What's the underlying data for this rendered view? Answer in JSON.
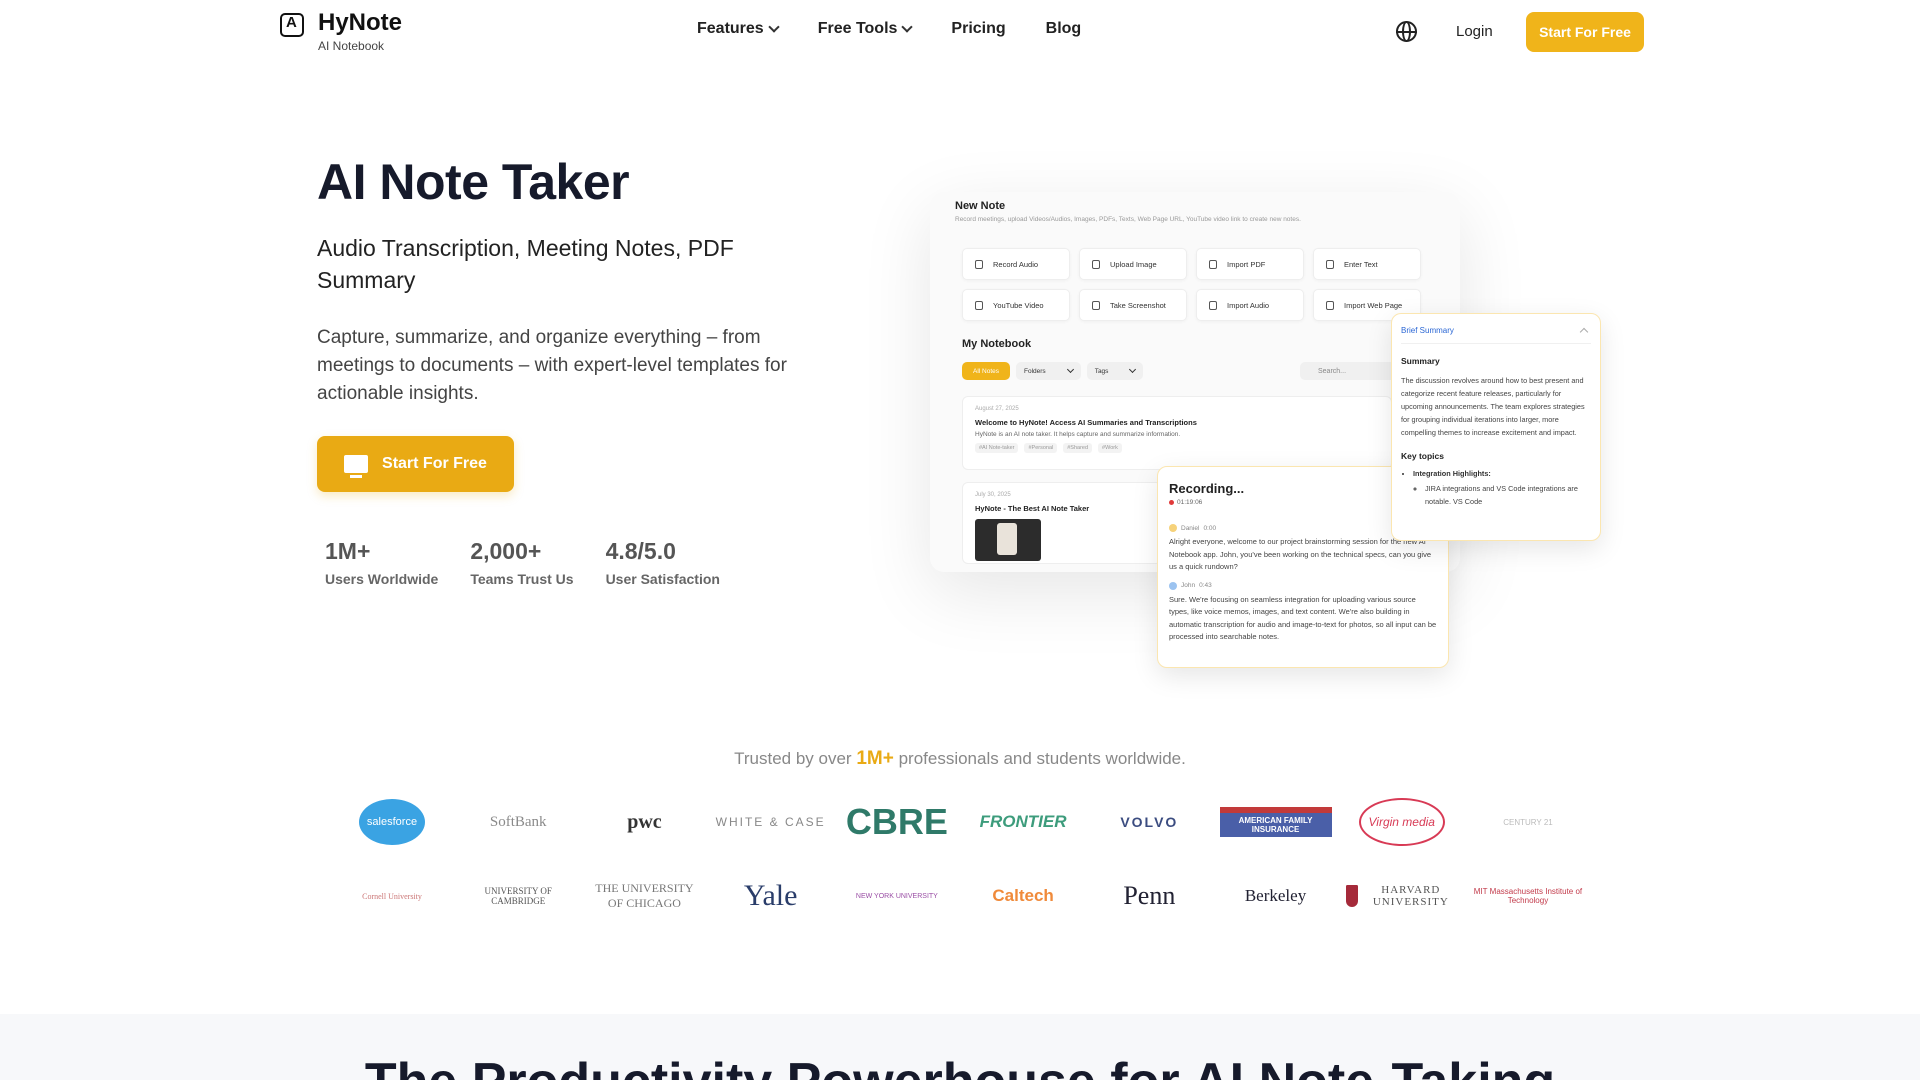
{
  "nav": {
    "brand": "HyNote",
    "brand_sub": "AI Notebook",
    "links": [
      "Features",
      "Free Tools",
      "Pricing",
      "Blog"
    ],
    "login": "Login",
    "cta": "Start For Free"
  },
  "hero": {
    "title": "AI Note Taker",
    "subtitle": "Audio Transcription, Meeting Notes, PDF Summary",
    "description": "Capture, summarize, and organize everything – from meetings to documents – with expert-level templates for actionable insights.",
    "cta": "Start For Free",
    "stats": [
      {
        "num": "1M+",
        "label": "Users Worldwide"
      },
      {
        "num": "2,000+",
        "label": "Teams Trust Us"
      },
      {
        "num": "4.8/5.0",
        "label": "User Satisfaction"
      }
    ]
  },
  "mockup": {
    "new_note_title": "New Note",
    "new_note_hint": "Record meetings, upload Videos/Audios, Images, PDFs, Texts, Web Page URL, YouTube video link to create new notes.",
    "actions": [
      "Record Audio",
      "Upload Image",
      "Import PDF",
      "Enter Text",
      "YouTube Video",
      "Take Screenshot",
      "Import Audio",
      "Import Web Page"
    ],
    "notebook_title": "My Notebook",
    "filters": {
      "all": "All Notes",
      "folders": "Folders",
      "tags": "Tags",
      "search": "Search..."
    },
    "note1": {
      "date": "August 27, 2025",
      "title": "Welcome to HyNote! Access AI Summaries and Transcriptions",
      "desc": "HyNote is an AI note taker. It helps capture and summarize information.",
      "tags": [
        "#AI Note-taker",
        "#Personal",
        "#Shared",
        "#Work"
      ]
    },
    "note2": {
      "date": "July 30, 2025",
      "title": "HyNote - The Best AI Note Taker"
    },
    "recording": {
      "title": "Recording...",
      "time": "01:19:06",
      "speaker1": "Daniel",
      "speaker1_time": "0:00",
      "text1": "Alright everyone, welcome to our project brainstorming session for the new AI Notebook app. John, you've been working on the technical specs, can you give us a quick rundown?",
      "speaker2": "John",
      "speaker2_time": "0:43",
      "text2": "Sure. We're focusing on seamless integration for uploading various source types, like voice memos, images, and text content. We're also building in automatic transcription for audio and image-to-text for photos, so all input can be processed into searchable notes."
    },
    "summary": {
      "header": "Brief Summary",
      "title": "Summary",
      "text": "The discussion revolves around how to best present and categorize recent feature releases, particularly for upcoming announcements. The team explores strategies for grouping individual iterations into larger, more compelling themes to increase excitement and impact.",
      "key_topics": "Key topics",
      "topic1": "Integration Highlights:",
      "topic1_sub": "JIRA integrations and VS Code integrations are notable. VS Code"
    }
  },
  "trusted": {
    "prefix": "Trusted by over",
    "highlight": "1M+",
    "suffix": "professionals and students worldwide."
  },
  "logos_row1": [
    "salesforce",
    "SoftBank",
    "pwc",
    "WHITE & CASE",
    "CBRE",
    "FRONTIER",
    "VOLVO",
    "AMERICAN FAMILY INSURANCE",
    "Virgin media",
    "CENTURY 21"
  ],
  "logos_row2": [
    "Cornell University",
    "UNIVERSITY OF CAMBRIDGE",
    "THE UNIVERSITY OF CHICAGO",
    "Yale",
    "NEW YORK UNIVERSITY",
    "Caltech",
    "Penn",
    "Berkeley",
    "HARVARD UNIVERSITY",
    "MIT Massachusetts Institute of Technology"
  ],
  "section_title": "The Productivity Powerhouse for AI Note-Taking",
  "colors": {
    "accent": "#f0b41a",
    "accent_dark": "#e9aa14",
    "text": "#161a2b",
    "link_blue": "#2a66d4"
  }
}
